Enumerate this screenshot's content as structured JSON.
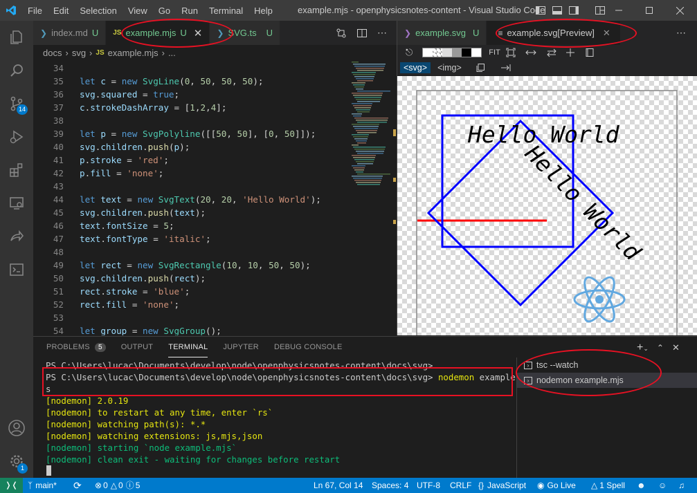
{
  "window": {
    "title": "example.mjs - openphysicsnotes-content - Visual Studio Code"
  },
  "menu": [
    "File",
    "Edit",
    "Selection",
    "View",
    "Go",
    "Run",
    "Terminal",
    "Help"
  ],
  "activity": {
    "scm_badge": "14",
    "account_badge": "1"
  },
  "editor_tabs": [
    {
      "icon": "markdown-icon",
      "label": "index.md",
      "status": "U"
    },
    {
      "icon": "js-icon",
      "icon_text": "JS",
      "label": "example.mjs",
      "status": "U",
      "active": true
    },
    {
      "icon": "ts-icon",
      "label": "SVG.ts",
      "status": "U"
    }
  ],
  "breadcrumb": {
    "parts": [
      "docs",
      "svg",
      "example.mjs",
      "..."
    ],
    "file_icon_text": "JS"
  },
  "code": {
    "lines": [
      {
        "n": "34",
        "text": ""
      },
      {
        "n": "35",
        "text": "let c = new SvgLine(0, 50, 50, 50);"
      },
      {
        "n": "36",
        "text": "svg.squared = true;"
      },
      {
        "n": "37",
        "text": "c.strokeDashArray = [1,2,4];"
      },
      {
        "n": "38",
        "text": ""
      },
      {
        "n": "39",
        "text": "let p = new SvgPolyline([[50, 50], [0, 50]]);"
      },
      {
        "n": "40",
        "text": "svg.children.push(p);"
      },
      {
        "n": "41",
        "text": "p.stroke = 'red';"
      },
      {
        "n": "42",
        "text": "p.fill = 'none';"
      },
      {
        "n": "43",
        "text": ""
      },
      {
        "n": "44",
        "text": "let text = new SvgText(20, 20, 'Hello World');"
      },
      {
        "n": "45",
        "text": "svg.children.push(text);"
      },
      {
        "n": "46",
        "text": "text.fontSize = 5;"
      },
      {
        "n": "47",
        "text": "text.fontType = 'italic';"
      },
      {
        "n": "48",
        "text": ""
      },
      {
        "n": "49",
        "text": "let rect = new SvgRectangle(10, 10, 50, 50);"
      },
      {
        "n": "50",
        "text": "svg.children.push(rect);"
      },
      {
        "n": "51",
        "text": "rect.stroke = 'blue';"
      },
      {
        "n": "52",
        "text": "rect.fill = 'none';"
      },
      {
        "n": "53",
        "text": ""
      },
      {
        "n": "54",
        "text": "let group = new SvgGroup();"
      }
    ]
  },
  "preview_tabs": [
    {
      "icon": "svg-file-icon",
      "label": "example.svg",
      "status": "U"
    },
    {
      "icon": "preview-icon",
      "label": "example.svg[Preview]",
      "active": true
    }
  ],
  "preview_toolbar": {
    "fit": "FIT",
    "svg_tab": "<svg>",
    "img_tab": "<img>"
  },
  "preview_content": {
    "text1": "Hello World",
    "text2": "Hello World"
  },
  "panel": {
    "tabs": [
      {
        "label": "PROBLEMS",
        "count": "5"
      },
      {
        "label": "OUTPUT"
      },
      {
        "label": "TERMINAL",
        "active": true
      },
      {
        "label": "JUPYTER"
      },
      {
        "label": "DEBUG CONSOLE"
      }
    ],
    "terminal_lines": [
      {
        "text": "PS C:\\Users\\lucac\\Documents\\develop\\node\\openphysicsnotes-content\\docs\\svg>",
        "color": "plain"
      },
      {
        "text": "PS C:\\Users\\lucac\\Documents\\develop\\node\\openphysicsnotes-content\\docs\\svg> ",
        "cmd": "nodemon",
        "arg": " example.mj",
        "color": "prompt"
      },
      {
        "text": "s",
        "color": "plain"
      },
      {
        "text": "[nodemon] 2.0.19",
        "color": "yel"
      },
      {
        "text": "[nodemon] to restart at any time, enter `rs`",
        "color": "yel"
      },
      {
        "text": "[nodemon] watching path(s): *.*",
        "color": "yel"
      },
      {
        "text": "[nodemon] watching extensions: js,mjs,json",
        "color": "yel"
      },
      {
        "text": "[nodemon] starting `node example.mjs`",
        "color": "grn"
      },
      {
        "text": "[nodemon] clean exit - waiting for changes before restart",
        "color": "grn"
      }
    ],
    "terminals": [
      {
        "label": "tsc --watch"
      },
      {
        "label": "nodemon example.mjs",
        "active": true
      }
    ]
  },
  "status": {
    "branch": "main*",
    "errors": "0",
    "warnings": "0",
    "info": "5",
    "position": "Ln 67, Col 14",
    "spaces": "Spaces: 4",
    "encoding": "UTF-8",
    "eol": "CRLF",
    "language": "JavaScript",
    "golive": "Go Live",
    "spell": "1 Spell"
  },
  "colors": {
    "accent": "#007acc",
    "annotation": "#e81123",
    "activity_bg": "#333333",
    "editor_bg": "#1e1e1e"
  }
}
